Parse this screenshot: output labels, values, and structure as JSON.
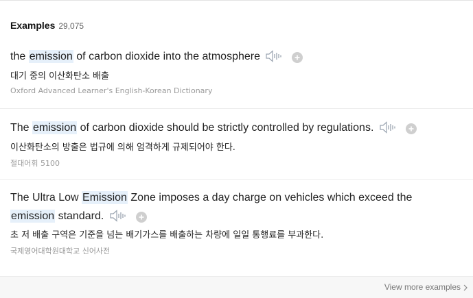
{
  "header": {
    "title": "Examples",
    "count": "29,075"
  },
  "examples": [
    {
      "parts": [
        "the ",
        "emission",
        " of carbon dioxide into the atmosphere"
      ],
      "translation": "대기 중의 이산화탄소 배출",
      "source": "Oxford Advanced Learner's English-Korean Dictionary"
    },
    {
      "parts": [
        "The ",
        "emission",
        " of carbon dioxide should be strictly controlled by regulations."
      ],
      "translation": "이산화탄소의 방출은 법규에 의해 엄격하게 규제되어야 한다.",
      "source": "절대어휘 5100"
    },
    {
      "parts": [
        "The Ultra Low ",
        "Emission",
        " Zone imposes a day charge on vehicles which exceed the ",
        "emission",
        " standard."
      ],
      "translation": "초 저 배출 구역은 기준을 넘는 배기가스를 배출하는 차량에 일일 통행료를 부과한다.",
      "source": "국제영어대학원대학교 신어사전"
    }
  ],
  "footer": {
    "view_more": "View more examples"
  },
  "icons": {
    "speaker": "speaker-icon",
    "add": "plus-circle-icon",
    "chevron": "chevron-right-icon"
  },
  "colors": {
    "highlight": "#e6f0fa",
    "icon_gray": "#c8c8c8"
  }
}
